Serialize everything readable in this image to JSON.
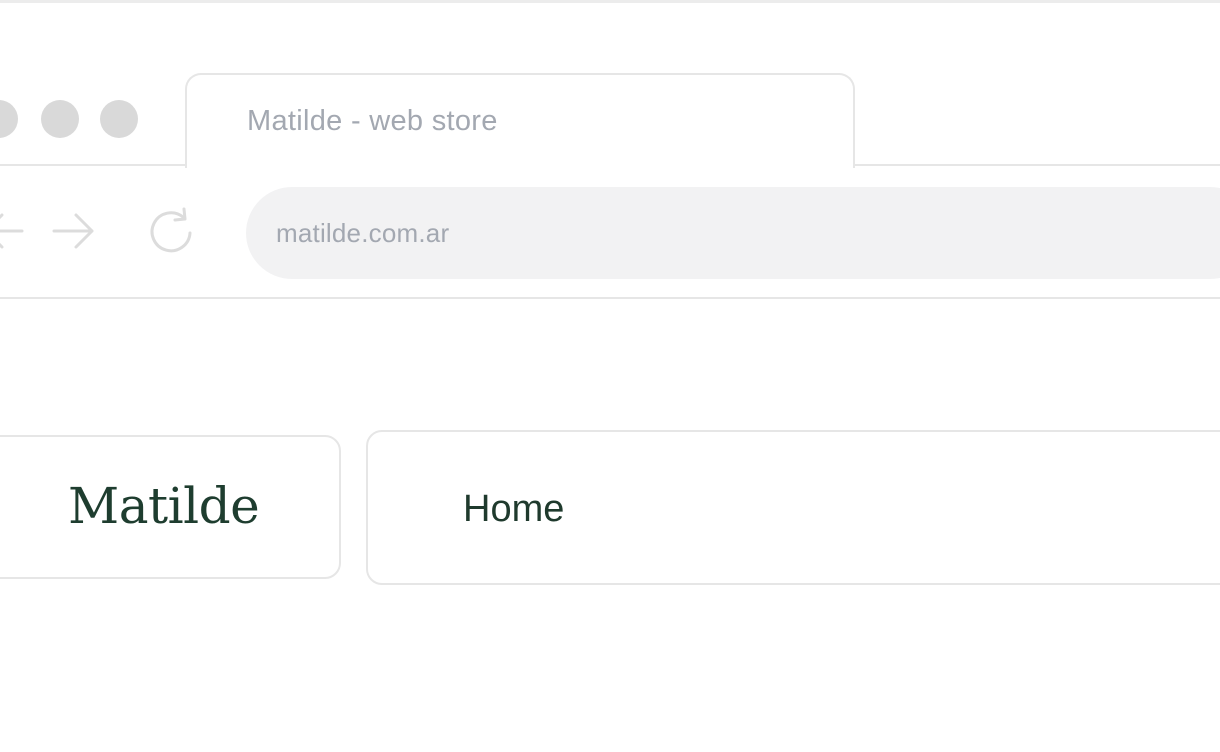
{
  "window": {
    "controls": [
      "window-dot",
      "window-dot",
      "window-dot"
    ],
    "tab": {
      "title": "Matilde - web store"
    }
  },
  "toolbar": {
    "back_icon": "arrow-left-icon",
    "forward_icon": "arrow-right-icon",
    "reload_icon": "reload-icon",
    "address": "matilde.com.ar"
  },
  "page": {
    "logo": "Matilde",
    "nav": {
      "items": [
        {
          "label": "Home"
        }
      ]
    }
  },
  "colors": {
    "chrome_border": "#e6e6e6",
    "dot": "#d9d9d9",
    "muted_text": "#a3a8b1",
    "address_bg": "#f2f2f3",
    "brand_green": "#1e3d2f"
  }
}
